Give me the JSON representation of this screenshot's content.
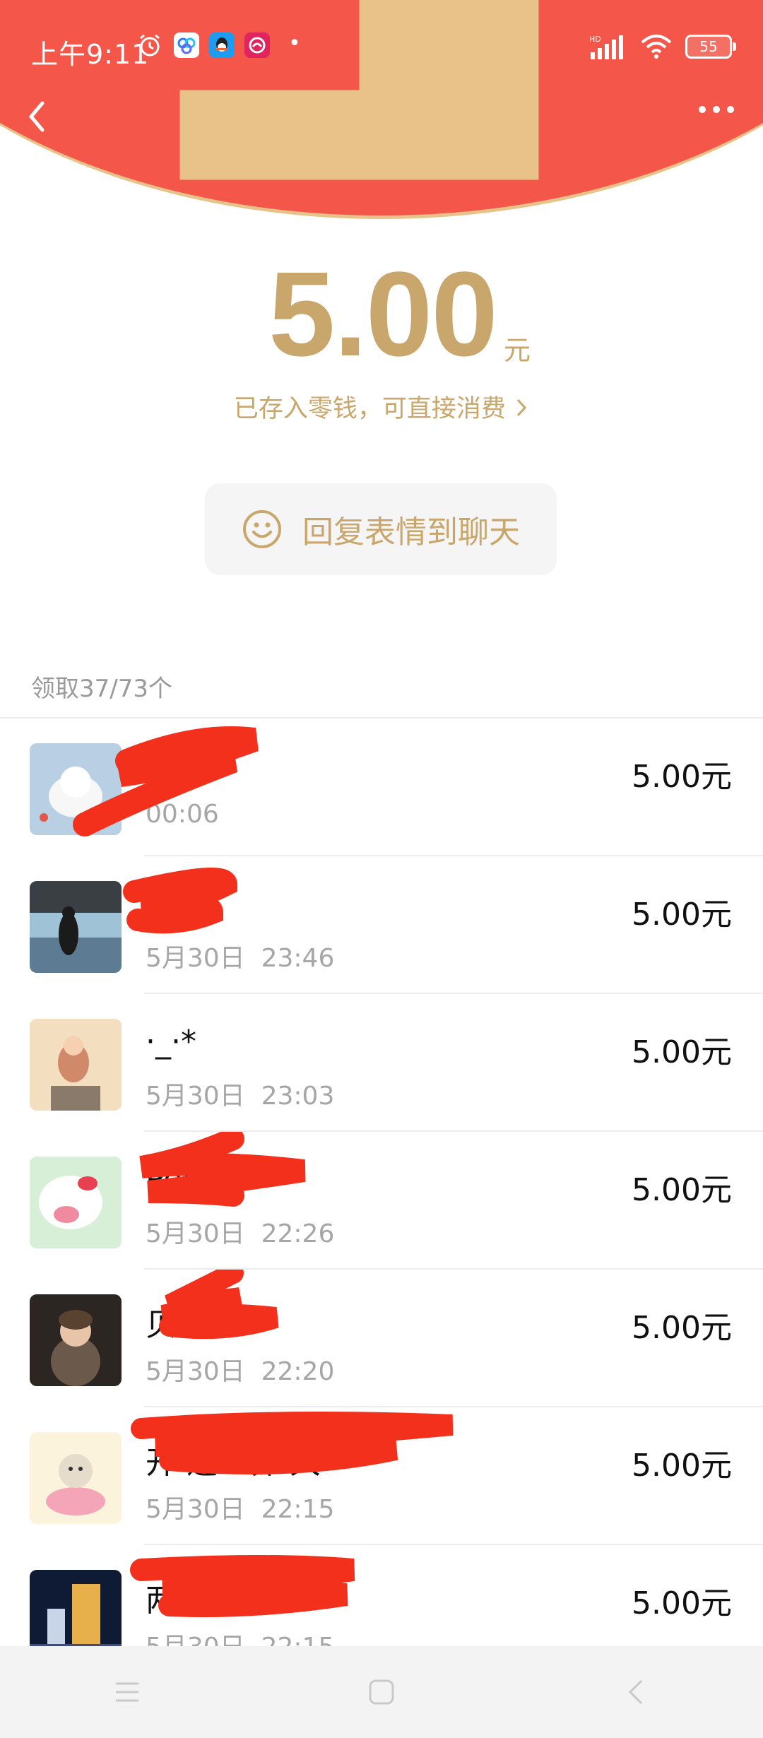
{
  "status_bar": {
    "time": "上午9:11",
    "battery": "55",
    "icons": [
      "alarm-icon",
      "baidu-cloud-icon",
      "qq-icon",
      "app-icon",
      "signal-icon",
      "wifi-icon",
      "battery-icon"
    ]
  },
  "header": {
    "back_icon": "chevron-left-icon",
    "more_icon": "more-dots-icon",
    "color": "#f45749"
  },
  "red_packet": {
    "amount": "5.00",
    "unit": "元",
    "stored_note": "已存入零钱，可直接消费",
    "reply_button_label": "回复表情到聊天",
    "accent_color": "#c9a66b"
  },
  "claims": {
    "count_label": "领取37/73个",
    "items": [
      {
        "name": "",
        "time": "00:06",
        "amount": "5.00元"
      },
      {
        "name": "",
        "time": "5月30日  23:46",
        "amount": "5.00元"
      },
      {
        "name": "·_·*",
        "time": "5月30日  23:03",
        "amount": "5.00元"
      },
      {
        "name": "Pen  on",
        "time": "5月30日  22:26",
        "amount": "5.00元"
      },
      {
        "name": "贝",
        "time": "5月30日  22:20",
        "amount": "5.00元"
      },
      {
        "name": "开  迎世界  大",
        "time": "5月30日  22:15",
        "amount": "5.00元"
      },
      {
        "name": "两",
        "time": "5月30日  22:15",
        "amount": "5.00元"
      }
    ]
  },
  "nav_bar": {
    "icons": [
      "menu-icon",
      "home-icon",
      "back-icon"
    ]
  }
}
